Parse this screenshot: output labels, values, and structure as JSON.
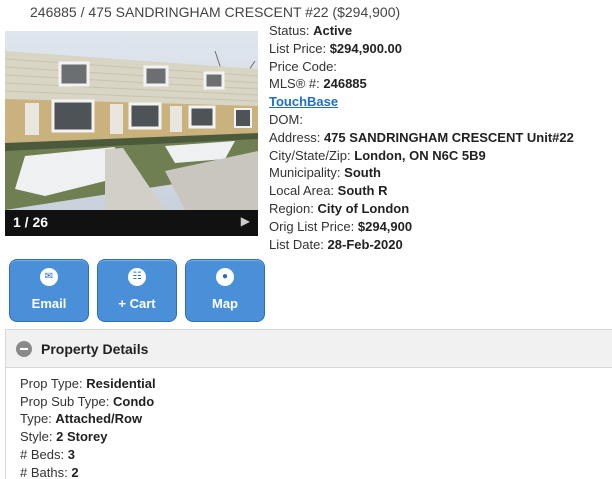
{
  "header": {
    "title": "246885 / 475 SANDRINGHAM CRESCENT #22 ($294,900)"
  },
  "photo": {
    "counter": "1 / 26",
    "next_icon": "chevron-right-icon"
  },
  "listing": {
    "status_label": "Status:",
    "status": "Active",
    "list_price_label": "List Price:",
    "list_price": "$294,900.00",
    "price_code_label": "Price Code:",
    "price_code": "",
    "mls_label": "MLS® #:",
    "mls": "246885",
    "touchbase_link": "TouchBase",
    "dom_label": "DOM:",
    "dom": "",
    "address_label": "Address:",
    "address": "475 SANDRINGHAM CRESCENT Unit#22",
    "city_label": "City/State/Zip:",
    "city": "London, ON N6C 5B9",
    "municipality_label": "Municipality:",
    "municipality": "South",
    "local_area_label": "Local Area:",
    "local_area": "South R",
    "region_label": "Region:",
    "region": "City of London",
    "orig_price_label": "Orig List Price:",
    "orig_price": "$294,900",
    "list_date_label": "List Date:",
    "list_date": "28-Feb-2020"
  },
  "actions": {
    "email_label": "Email",
    "email_icon": "envelope-icon",
    "cart_label": "+ Cart",
    "cart_icon": "cart-icon",
    "map_label": "Map",
    "map_icon": "globe-icon",
    "accent": "#4a90d9"
  },
  "property_details": {
    "heading": "Property Details",
    "prop_type_label": "Prop Type:",
    "prop_type": "Residential",
    "prop_sub_type_label": "Prop Sub Type:",
    "prop_sub_type": "Condo",
    "type_label": "Type:",
    "type": "Attached/Row",
    "style_label": "Style:",
    "style": "2 Storey",
    "beds_label": "# Beds:",
    "beds": "3",
    "baths_label": "# Baths:",
    "baths": "2"
  }
}
